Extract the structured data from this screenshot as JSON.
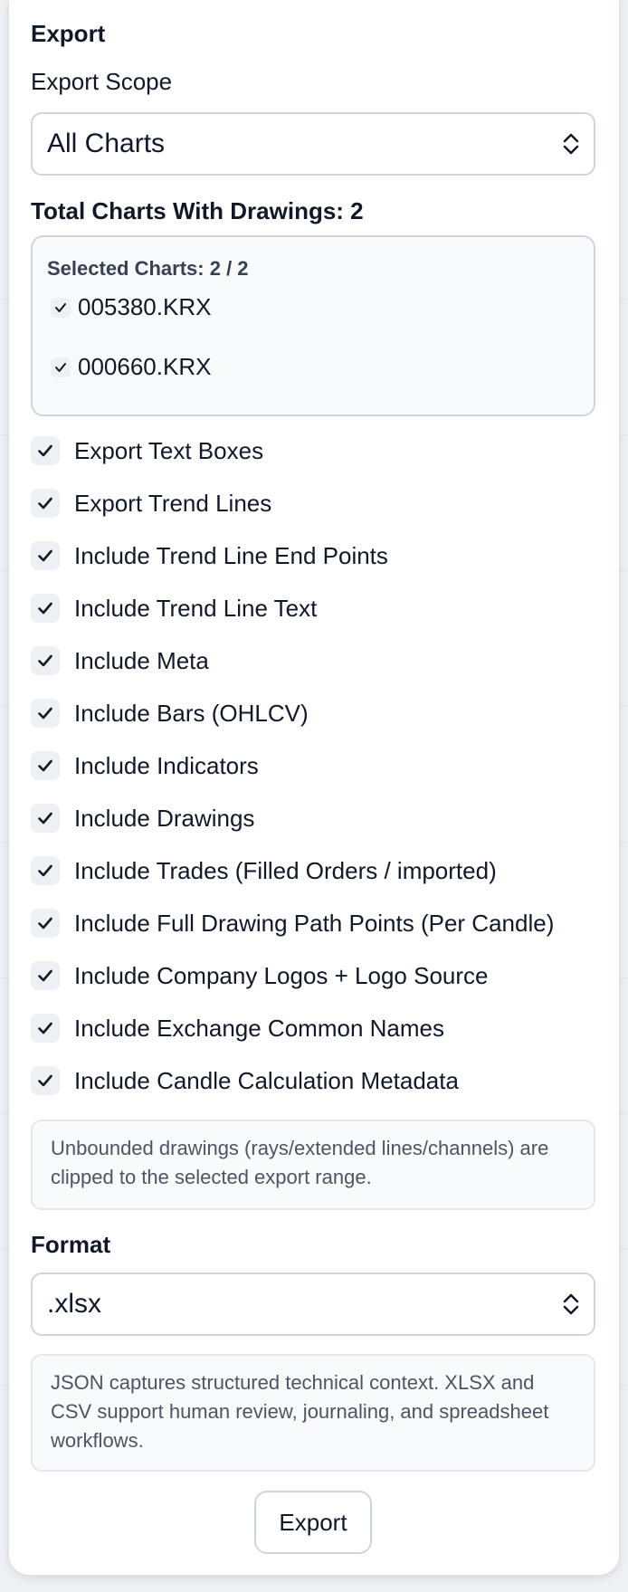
{
  "panel": {
    "title": "Export"
  },
  "scope": {
    "label": "Export Scope",
    "selected": "All Charts"
  },
  "charts": {
    "total_label": "Total Charts With Drawings: 2",
    "selected_label": "Selected Charts: 2 / 2",
    "items": [
      {
        "symbol": "005380.KRX",
        "checked": true
      },
      {
        "symbol": "000660.KRX",
        "checked": true
      }
    ]
  },
  "options": [
    {
      "label": "Export Text Boxes",
      "checked": true
    },
    {
      "label": "Export Trend Lines",
      "checked": true
    },
    {
      "label": "Include Trend Line End Points",
      "checked": true
    },
    {
      "label": "Include Trend Line Text",
      "checked": true
    },
    {
      "label": "Include Meta",
      "checked": true
    },
    {
      "label": "Include Bars (OHLCV)",
      "checked": true
    },
    {
      "label": "Include Indicators",
      "checked": true
    },
    {
      "label": "Include Drawings",
      "checked": true
    },
    {
      "label": "Include Trades (Filled Orders / imported)",
      "checked": true
    },
    {
      "label": "Include Full Drawing Path Points (Per Candle)",
      "checked": true
    },
    {
      "label": "Include Company Logos + Logo Source",
      "checked": true
    },
    {
      "label": "Include Exchange Common Names",
      "checked": true
    },
    {
      "label": "Include Candle Calculation Metadata",
      "checked": true
    }
  ],
  "range_note": "Unbounded drawings (rays/extended lines/channels) are clipped to the selected export range.",
  "format": {
    "label": "Format",
    "selected": ".xlsx"
  },
  "format_note": "JSON captures structured technical context. XLSX and CSV support human review, journaling, and spreadsheet workflows.",
  "export_button": "Export",
  "icons": {
    "check": "check-icon",
    "select_arrows": "chevron-up-down-icon"
  },
  "colors": {
    "panel_bg": "#ffffff",
    "border": "#d1d5db",
    "muted_text": "#4b5563",
    "checkbox_bg": "#eef0f3"
  }
}
